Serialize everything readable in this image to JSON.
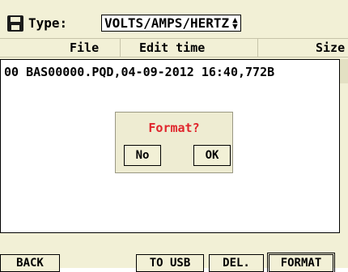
{
  "header": {
    "type_label": "Type:",
    "type_value": "VOLTS/AMPS/HERTZ",
    "spin_up": "▲",
    "spin_down": "▼"
  },
  "columns": [
    "File",
    "Edit time",
    "Size"
  ],
  "files": [
    {
      "text": "00 BAS00000.PQD,04-09-2012 16:40,772B"
    }
  ],
  "dialog": {
    "title": "Format?",
    "no": "No",
    "ok": "OK"
  },
  "footer": {
    "back": "BACK",
    "to_usb": "TO USB",
    "del": "DEL.",
    "format": "FORMAT"
  },
  "colors": {
    "background": "#f2f0d6",
    "list_bg": "#ffffff",
    "dialog_title": "#e0252c"
  }
}
